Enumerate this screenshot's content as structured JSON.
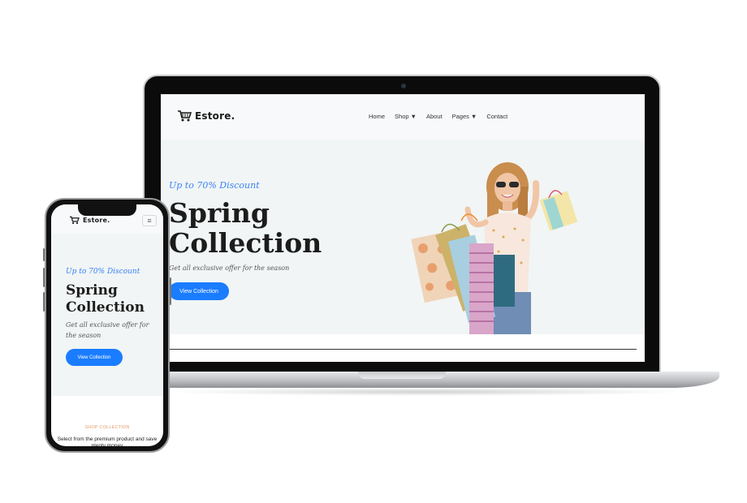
{
  "brand": {
    "name": "Estore."
  },
  "nav": {
    "items": [
      {
        "label": "Home",
        "dropdown": false
      },
      {
        "label": "Shop",
        "dropdown": true
      },
      {
        "label": "About",
        "dropdown": false
      },
      {
        "label": "Pages",
        "dropdown": true
      },
      {
        "label": "Contact",
        "dropdown": false
      }
    ]
  },
  "hero": {
    "discount": "Up to 70% Discount",
    "title_line1": "Spring",
    "title_line2": "Collection",
    "subtitle": "Get all exclusive offer for the season",
    "cta": "View Collection"
  },
  "section": {
    "eyebrow": "SHOP COLLECTION",
    "description": "Select from the premium product and save plenty money"
  },
  "colors": {
    "accent_blue": "#1a7cff",
    "script_blue": "#3b82f6",
    "hero_bg": "#f1f5f5",
    "eyebrow": "#e39b6d"
  },
  "icons": {
    "cart": "shopping-cart-icon",
    "menu": "hamburger-icon"
  }
}
